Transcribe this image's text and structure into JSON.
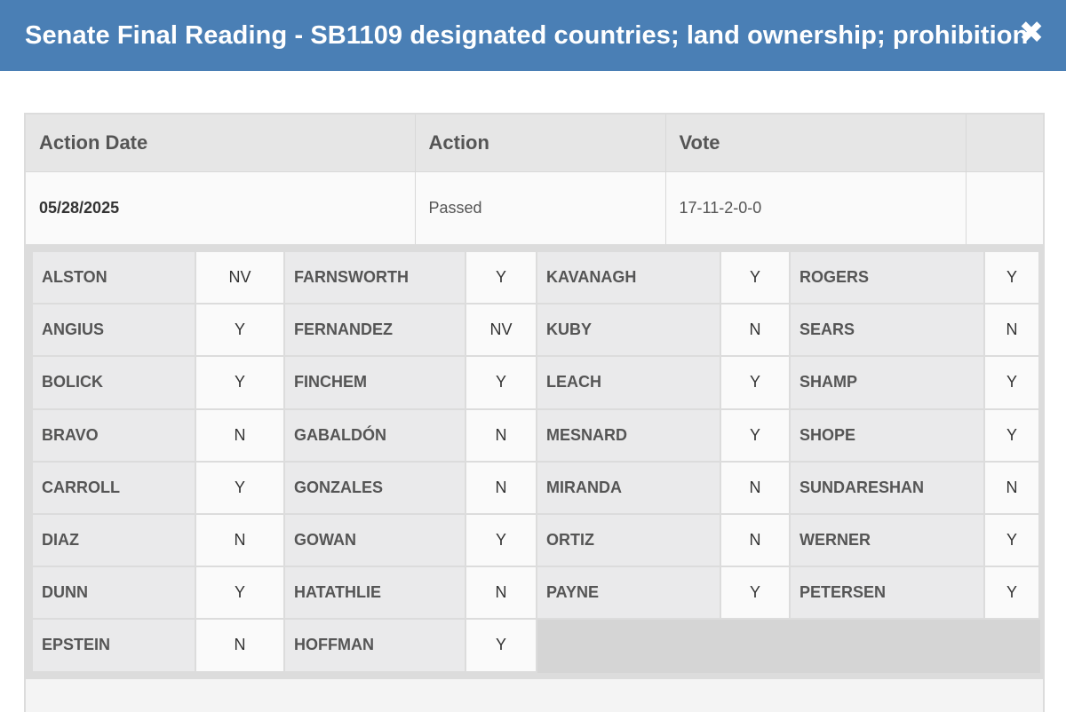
{
  "header": {
    "title": "Senate Final Reading - SB1109 designated countries; land ownership; prohibition",
    "close_icon": "✖"
  },
  "summary": {
    "columns": [
      "Action Date",
      "Action",
      "Vote",
      ""
    ],
    "row": {
      "date": "05/28/2025",
      "action": "Passed",
      "vote": "17-11-2-0-0"
    }
  },
  "votes": [
    {
      "name": "ALSTON",
      "vote": "NV"
    },
    {
      "name": "FARNSWORTH",
      "vote": "Y"
    },
    {
      "name": "KAVANAGH",
      "vote": "Y"
    },
    {
      "name": "ROGERS",
      "vote": "Y"
    },
    {
      "name": "ANGIUS",
      "vote": "Y"
    },
    {
      "name": "FERNANDEZ",
      "vote": "NV"
    },
    {
      "name": "KUBY",
      "vote": "N"
    },
    {
      "name": "SEARS",
      "vote": "N"
    },
    {
      "name": "BOLICK",
      "vote": "Y"
    },
    {
      "name": "FINCHEM",
      "vote": "Y"
    },
    {
      "name": "LEACH",
      "vote": "Y"
    },
    {
      "name": "SHAMP",
      "vote": "Y"
    },
    {
      "name": "BRAVO",
      "vote": "N"
    },
    {
      "name": "GABALDÓN",
      "vote": "N"
    },
    {
      "name": "MESNARD",
      "vote": "Y"
    },
    {
      "name": "SHOPE",
      "vote": "Y"
    },
    {
      "name": "CARROLL",
      "vote": "Y"
    },
    {
      "name": "GONZALES",
      "vote": "N"
    },
    {
      "name": "MIRANDA",
      "vote": "N"
    },
    {
      "name": "SUNDARESHAN",
      "vote": "N"
    },
    {
      "name": "DIAZ",
      "vote": "N"
    },
    {
      "name": "GOWAN",
      "vote": "Y"
    },
    {
      "name": "ORTIZ",
      "vote": "N"
    },
    {
      "name": "WERNER",
      "vote": "Y"
    },
    {
      "name": "DUNN",
      "vote": "Y"
    },
    {
      "name": "HATATHLIE",
      "vote": "N"
    },
    {
      "name": "PAYNE",
      "vote": "Y"
    },
    {
      "name": "PETERSEN",
      "vote": "Y"
    },
    {
      "name": "EPSTEIN",
      "vote": "N"
    },
    {
      "name": "HOFFMAN",
      "vote": "Y"
    }
  ],
  "colors": {
    "header_bg": "#4a7fb5",
    "header_text": "#ffffff"
  }
}
